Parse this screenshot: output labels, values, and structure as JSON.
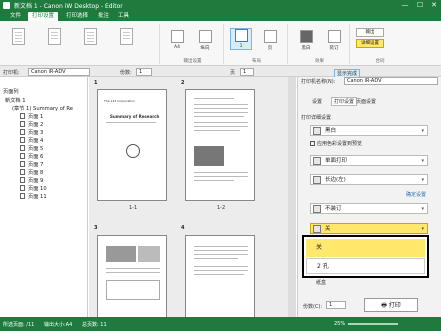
{
  "window": {
    "title": "新文档 1 - Canon iW Desktop - Editor",
    "min": "—",
    "max": "☐",
    "close": "✕"
  },
  "tabs": [
    "文件",
    "打印设置",
    "打印选择",
    "批注",
    "工具"
  ],
  "ribbon": {
    "size": "A4",
    "orientation": "纵向",
    "pages": "1",
    "layout": "页",
    "color": "黑白",
    "finishing": "装订",
    "output_label": "输出",
    "print_label": "打印",
    "setting_label": "详细设置",
    "groups": [
      "输出设置",
      "布局",
      "效果",
      "合同"
    ]
  },
  "toolbar": {
    "printer_label": "打印机:",
    "printer": "Canon iR-ADV",
    "copies_label": "份数:",
    "copies": "1",
    "page_label": "页",
    "page_value": "1",
    "finish": "显示完成"
  },
  "left": {
    "header": "页面列",
    "root": "新文档 1",
    "section": "(章节 1) Summary of Re",
    "pages": [
      "页面 1",
      "页面 2",
      "页面 3",
      "页面 4",
      "页面 5",
      "页面 6",
      "页面 7",
      "页面 8",
      "页面 9",
      "页面 10",
      "页面 11"
    ]
  },
  "center": {
    "page_nums": [
      "1",
      "2",
      "3",
      "4"
    ],
    "captions": [
      "1-1",
      "1-2"
    ],
    "doc_title": "Summary of Research",
    "doc_header": "The 123 Corporation"
  },
  "right": {
    "printer_label": "打印机名称(N):",
    "printer": "Canon iR-ADV",
    "subtabs": [
      "设置",
      "打印设置",
      "页面设置"
    ],
    "section_title": "打印详细设置",
    "color": "黑白",
    "apply_check": "应用色彩设置到预览",
    "sided": "单面打印",
    "staple_label": "长边(左)",
    "link": "确定设置",
    "bind": "不装订",
    "punch_selected": "关",
    "options": [
      "关",
      "2 孔"
    ],
    "tray_label": "纸盒",
    "copies_label": "份数(C):",
    "copies": "1",
    "print_btn": "打印"
  },
  "status": {
    "pages": "所选页面: /11",
    "size": "输出大小:A4",
    "total": "总页数: 11",
    "zoom": "25%"
  }
}
